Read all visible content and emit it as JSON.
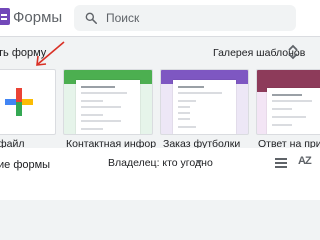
{
  "app": {
    "title": "Формы"
  },
  "search": {
    "placeholder": "Поиск"
  },
  "create": {
    "label": "ть форму",
    "gallery_label": "Галерея шаблонов"
  },
  "templates": [
    {
      "label": "файл"
    },
    {
      "label": "Контактная информ..."
    },
    {
      "label": "Заказ футболки"
    },
    {
      "label": "Ответ на пригла"
    }
  ],
  "recent": {
    "title": "ие формы",
    "owner_label": "Владелец: кто угодно"
  },
  "icons": {
    "search": "search-icon",
    "gallery": "unfold-icon",
    "plus": "plus-icon",
    "list": "list-view-icon",
    "sort": "sort-az-icon"
  },
  "colors": {
    "brand": "#7248b9",
    "contact_header": "#4caf50",
    "tshirt_header": "#7e57c2",
    "invite_header": "#8d3b5a",
    "annotation_arrow": "#d93025"
  }
}
